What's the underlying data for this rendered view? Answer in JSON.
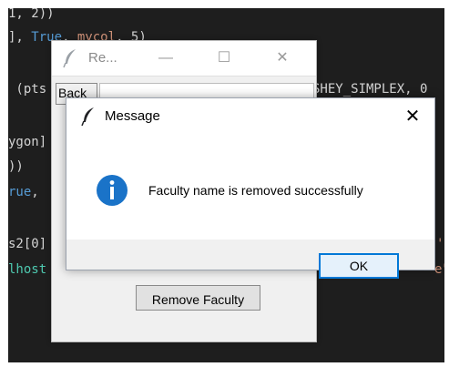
{
  "editor": {
    "lines": [
      {
        "pre": "1, 2))"
      },
      {
        "pre": "], ",
        "kw": "True",
        "mid": ", ",
        "orange": "mycol",
        "post": ", 5)"
      },
      {
        "pre": " (pts",
        "right": "SHEY_SIMPLEX, 0"
      },
      {
        "pre": "ygon]"
      },
      {
        "pre": "))"
      },
      {
        "kw": "rue",
        "post": ","
      },
      {
        "pre": "s2[0]",
        "right": "'"
      },
      {
        "cls": "lhost",
        "right": "e\""
      }
    ]
  },
  "back_window": {
    "title": "Re...",
    "minimize_glyph": "—",
    "maximize_glyph": "☐",
    "close_glyph": "✕",
    "back_button_label": "Back",
    "remove_button_label": "Remove Faculty"
  },
  "message_dialog": {
    "title": "Message",
    "close_glyph": "✕",
    "icon": "info-icon",
    "text": "Faculty name is removed successfully",
    "ok_label": "OK"
  },
  "colors": {
    "accent": "#0078d7",
    "editor_bg": "#1e1e1e",
    "info_blue": "#1a73c8"
  }
}
